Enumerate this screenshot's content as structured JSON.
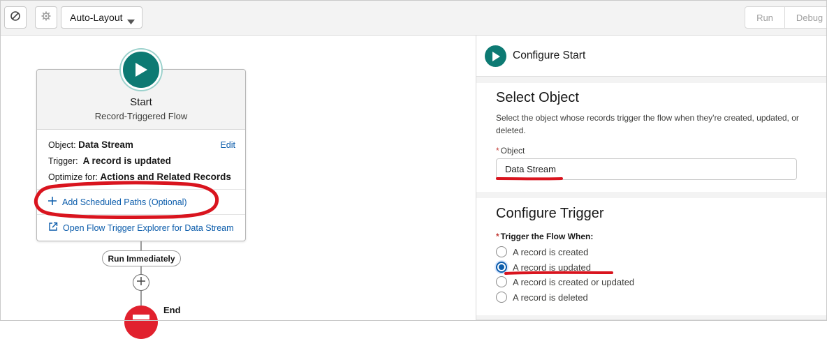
{
  "toolbar": {
    "layout_select": "Auto-Layout",
    "run_label": "Run",
    "debug_label": "Debug"
  },
  "canvas": {
    "start_card": {
      "title": "Start",
      "subtitle": "Record-Triggered Flow",
      "object_label": "Object:",
      "object_value": "Data Stream",
      "edit_label": "Edit",
      "trigger_label": "Trigger:",
      "trigger_value": "A record is updated",
      "optimize_label": "Optimize for:",
      "optimize_value": "Actions and Related Records",
      "add_paths_label": "Add Scheduled Paths (Optional)",
      "explorer_label": "Open Flow Trigger Explorer for Data Stream"
    },
    "run_immediately_label": "Run Immediately",
    "end_label": "End"
  },
  "panel": {
    "title": "Configure Start",
    "select_object": {
      "heading": "Select Object",
      "help": "Select the object whose records trigger the flow when they're created, updated, or deleted.",
      "field_label": "Object",
      "field_value": "Data Stream"
    },
    "configure_trigger": {
      "heading": "Configure Trigger",
      "field_label": "Trigger the Flow When:",
      "options": [
        {
          "label": "A record is created",
          "checked": false
        },
        {
          "label": "A record is updated",
          "checked": true
        },
        {
          "label": "A record is created or updated",
          "checked": false
        },
        {
          "label": "A record is deleted",
          "checked": false
        }
      ]
    }
  },
  "colors": {
    "accent_teal": "#0d7a73",
    "link_blue": "#0b5cab",
    "end_red": "#e1212e",
    "annotation_red": "#d9141e"
  }
}
